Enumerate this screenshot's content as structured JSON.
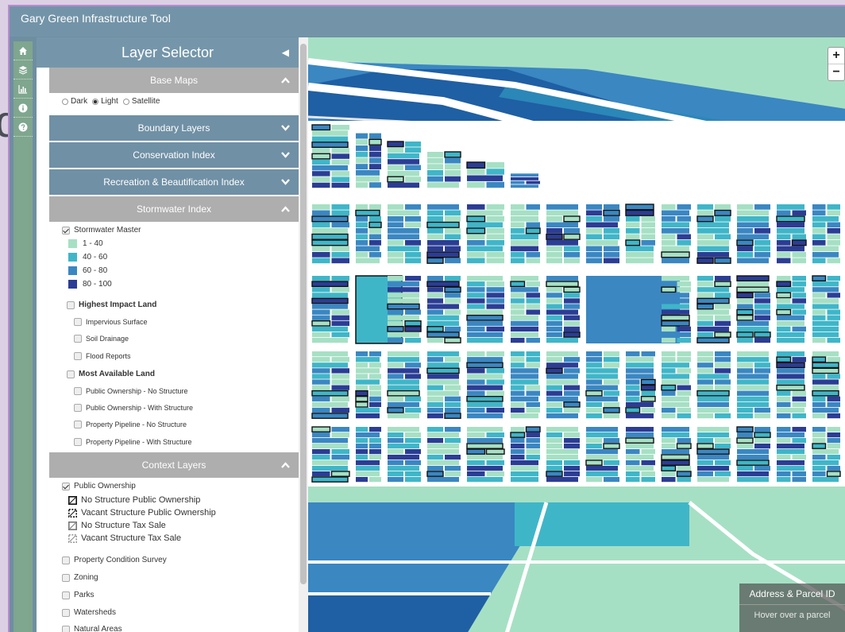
{
  "app": {
    "title": "Gary Green Infrastructure Tool"
  },
  "background_text": "d",
  "iconbar": {
    "icons": [
      "home-icon",
      "layers-icon",
      "chart-icon",
      "info-icon",
      "help-icon"
    ]
  },
  "panel": {
    "title": "Layer Selector",
    "sections": {
      "base_maps": {
        "label": "Base Maps",
        "state": "open"
      },
      "boundary": {
        "label": "Boundary Layers",
        "state": "closed"
      },
      "conservation": {
        "label": "Conservation Index",
        "state": "closed"
      },
      "recreation": {
        "label": "Recreation & Beautification Index",
        "state": "closed"
      },
      "stormwater": {
        "label": "Stormwater Index",
        "state": "open"
      },
      "context": {
        "label": "Context Layers",
        "state": "open"
      }
    },
    "basemap_options": [
      {
        "label": "Dark",
        "selected": false
      },
      {
        "label": "Light",
        "selected": true
      },
      {
        "label": "Satellite",
        "selected": false
      }
    ],
    "stormwater": {
      "master_label": "Stormwater Master",
      "master_checked": true,
      "legend": [
        {
          "label": "1 - 40",
          "color": "#a6e0c4"
        },
        {
          "label": "40 - 60",
          "color": "#3fb6c8"
        },
        {
          "label": "60 - 80",
          "color": "#3a87c2"
        },
        {
          "label": "80 - 100",
          "color": "#2b3d94"
        }
      ],
      "highest_impact": {
        "label": "Highest Impact Land",
        "items": [
          "Impervious Surface",
          "Soil Drainage",
          "Flood Reports"
        ]
      },
      "most_available": {
        "label": "Most Available Land",
        "items": [
          "Public Ownership - No Structure",
          "Public Ownership - With Structure",
          "Property Pipeline - No Structure",
          "Property Pipeline - With Structure"
        ]
      }
    },
    "context": {
      "public_ownership_label": "Public Ownership",
      "public_ownership_checked": true,
      "symbols": [
        "No Structure Public Ownership",
        "Vacant Structure Public Ownership",
        "No Structure Tax Sale",
        "Vacant Structure Tax Sale"
      ],
      "layers": [
        "Property Condition Survey",
        "Zoning",
        "Parks",
        "Watersheds",
        "Natural Areas"
      ]
    }
  },
  "map": {
    "zoom_in": "+",
    "zoom_out": "−",
    "info_title": "Address & Parcel ID",
    "info_hint": "Hover over a parcel"
  },
  "colors": {
    "titlebar": "#7394a8",
    "iconbar": "#7fa68f",
    "section_open": "#aeaeae",
    "section_closed": "#7090a5",
    "green": "#a6e0c4",
    "teal": "#3fb6c8",
    "blue": "#3a87c2",
    "navy": "#2b3d94"
  }
}
